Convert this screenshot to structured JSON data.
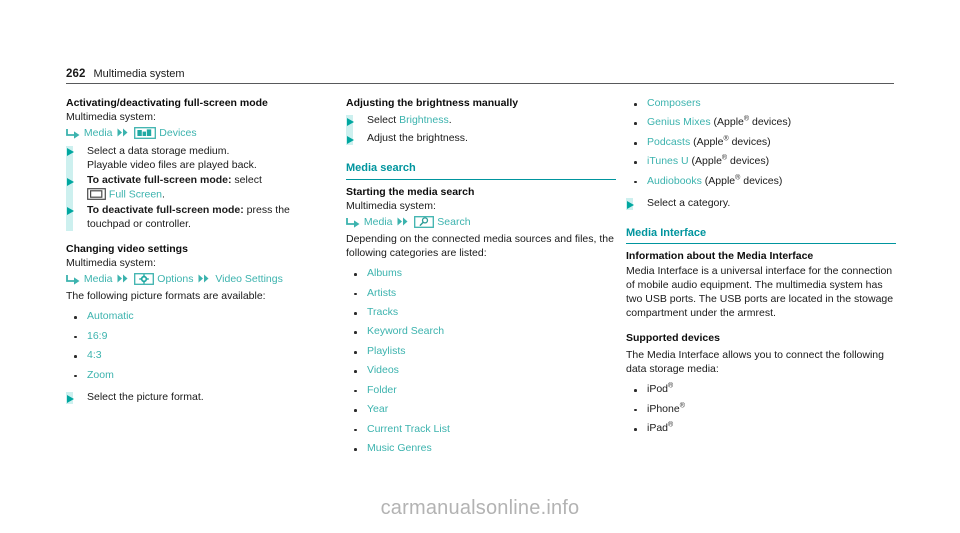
{
  "header": {
    "page_number": "262",
    "chapter": "Multimedia system"
  },
  "colors": {
    "heading_teal": "#00959e",
    "link_teal": "#3cb3ae",
    "marker_teal": "#00a7a0",
    "marker_bar": "#cdf0ef",
    "text": "#1a1a1a",
    "watermark": "#b3b3b3"
  },
  "col1": {
    "h_fullscreen": "Activating/deactivating full-screen mode",
    "multimedia_label_1": "Multimedia system:",
    "path1": {
      "arrow_icon": "enter-arrow-icon",
      "item1": "Media",
      "sep_icon": "double-arrow-icon",
      "device_icon": "devices-icon",
      "item2": "Devices"
    },
    "actions1": [
      {
        "text": "Select a data storage medium.",
        "line2": "Playable video files are played back."
      },
      {
        "bold": "To activate full-screen mode:",
        "text": " select"
      },
      {
        "bold": "To deactivate full-screen mode:",
        "text": " press the",
        "line2": "touchpad or controller."
      }
    ],
    "fullscreen_icon": "full-screen-icon",
    "fullscreen_link": "Full Screen",
    "fullscreen_period": ".",
    "h_video_settings": "Changing video settings",
    "multimedia_label_2": "Multimedia system:",
    "path2": {
      "arrow_icon": "enter-arrow-icon",
      "item1": "Media",
      "sep_icon": "double-arrow-icon",
      "options_icon": "options-gear-icon",
      "item2": "Options",
      "sep_icon2": "double-arrow-icon",
      "item3": "Video",
      "item3_cont": "Settings"
    },
    "formats_intro": "The following picture formats are available:",
    "formats": [
      "Automatic",
      "16:9",
      "4:3",
      "Zoom"
    ],
    "action_select_format": "Select the picture format."
  },
  "col2": {
    "h_brightness": "Adjusting the brightness manually",
    "actions_brightness": [
      {
        "text": "Select ",
        "link": "Brightness",
        "after": "."
      },
      {
        "text": "Adjust the brightness."
      }
    ],
    "h_media_search": "Media search",
    "h_starting": "Starting the media search",
    "multimedia_label": "Multimedia system:",
    "path": {
      "arrow_icon": "enter-arrow-icon",
      "item1": "Media",
      "sep_icon": "double-arrow-icon",
      "search_icon": "search-magnifier-icon",
      "item2": "Search"
    },
    "depending_text": "Depending on the connected media sources and files, the following categories are listed:",
    "categories": [
      "Albums",
      "Artists",
      "Tracks",
      "Keyword Search",
      "Playlists",
      "Videos",
      "Folder",
      "Year",
      "Current Track List",
      "Music Genres"
    ]
  },
  "col3": {
    "categories_cont": [
      {
        "link": "Composers",
        "note": ""
      },
      {
        "link": "Genius Mixes",
        "note": " (Apple",
        "sup": "®",
        "note2": " devices)"
      },
      {
        "link": "Podcasts",
        "note": " (Apple",
        "sup": "®",
        "note2": " devices)"
      },
      {
        "link": "iTunes U",
        "note": " (Apple",
        "sup": "®",
        "note2": " devices)"
      },
      {
        "link": "Audiobooks",
        "note": " (Apple",
        "sup": "®",
        "note2": " devices)"
      }
    ],
    "action_select_category": "Select a category.",
    "h_media_interface": "Media Interface",
    "h_information": "Information about the Media Interface",
    "info_text": "Media Interface is a universal interface for the connection of mobile audio equipment. The multimedia system has two USB ports. The USB ports are located in the stowage compartment under the armrest.",
    "h_supported": "Supported devices",
    "supported_intro": "The Media Interface allows you to connect the following data storage media:",
    "devices": [
      {
        "name": "iPod",
        "sup": "®"
      },
      {
        "name": "iPhone",
        "sup": "®"
      },
      {
        "name": "iPad",
        "sup": "®"
      }
    ]
  },
  "watermark": {
    "text": "carmanualsonline.info"
  }
}
